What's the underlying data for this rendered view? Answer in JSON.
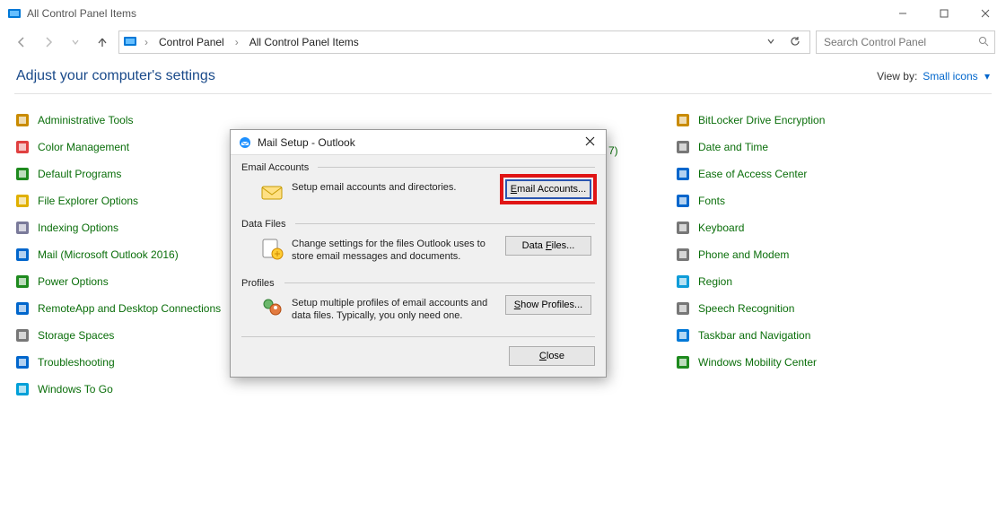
{
  "window": {
    "title": "All Control Panel Items",
    "breadcrumbs": [
      "Control Panel",
      "All Control Panel Items"
    ],
    "search_placeholder": "Search Control Panel"
  },
  "header": {
    "heading": "Adjust your computer's settings",
    "viewby_label": "View by:",
    "viewby_value": "Small icons"
  },
  "columns": {
    "left": [
      {
        "label": "Administrative Tools",
        "icon": "tools-icon"
      },
      {
        "label": "Color Management",
        "icon": "color-icon"
      },
      {
        "label": "Default Programs",
        "icon": "programs-icon"
      },
      {
        "label": "File Explorer Options",
        "icon": "folder-options-icon"
      },
      {
        "label": "Indexing Options",
        "icon": "index-icon"
      },
      {
        "label": "Mail (Microsoft Outlook 2016)",
        "icon": "mail-icon"
      },
      {
        "label": "Power Options",
        "icon": "power-icon"
      },
      {
        "label": "RemoteApp and Desktop Connections",
        "icon": "remoteapp-icon"
      },
      {
        "label": "Storage Spaces",
        "icon": "storage-icon"
      },
      {
        "label": "Troubleshooting",
        "icon": "troubleshoot-icon"
      },
      {
        "label": "Windows To Go",
        "icon": "wintogo-icon"
      }
    ],
    "middle_visible_trail": "7)",
    "right": [
      {
        "label": "BitLocker Drive Encryption",
        "icon": "bitlocker-icon"
      },
      {
        "label": "Date and Time",
        "icon": "clock-icon"
      },
      {
        "label": "Ease of Access Center",
        "icon": "ease-icon"
      },
      {
        "label": "Fonts",
        "icon": "fonts-icon"
      },
      {
        "label": "Keyboard",
        "icon": "keyboard-icon"
      },
      {
        "label": "Phone and Modem",
        "icon": "phone-icon"
      },
      {
        "label": "Region",
        "icon": "region-icon"
      },
      {
        "label": "Speech Recognition",
        "icon": "speech-icon"
      },
      {
        "label": "Taskbar and Navigation",
        "icon": "taskbar-icon"
      },
      {
        "label": "Windows Mobility Center",
        "icon": "mobility-icon"
      }
    ]
  },
  "dialog": {
    "title": "Mail Setup - Outlook",
    "sections": {
      "email": {
        "legend": "Email Accounts",
        "text": "Setup email accounts and directories.",
        "button_pre": "",
        "button_u": "E",
        "button_post": "mail Accounts..."
      },
      "data": {
        "legend": "Data Files",
        "text": "Change settings for the files Outlook uses to store email messages and documents.",
        "button_pre": "Data ",
        "button_u": "F",
        "button_post": "iles..."
      },
      "profiles": {
        "legend": "Profiles",
        "text": "Setup multiple profiles of email accounts and data files. Typically, you only need one.",
        "button_pre": "",
        "button_u": "S",
        "button_post": "how Profiles..."
      }
    },
    "close_pre": "",
    "close_u": "C",
    "close_post": "lose"
  }
}
